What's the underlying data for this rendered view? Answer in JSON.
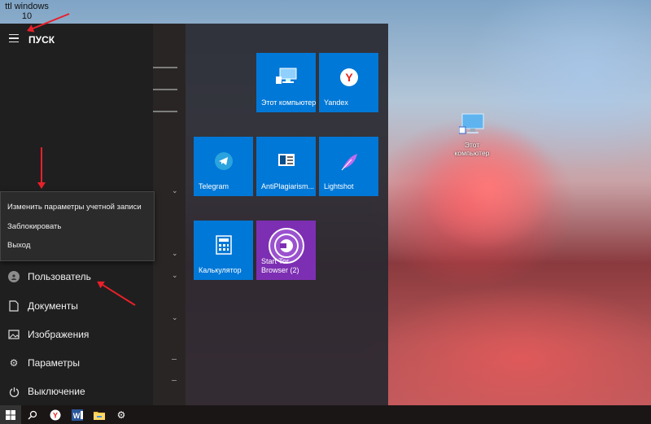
{
  "watermark": {
    "line1": "ttl windows",
    "line2": "10"
  },
  "start": {
    "title": "ПУСК",
    "account_menu": [
      "Изменить параметры учетной записи",
      "Заблокировать",
      "Выход"
    ],
    "rail_items": [
      {
        "icon": "user-avatar-icon",
        "label": "Пользователь"
      },
      {
        "icon": "document-icon",
        "label": "Документы"
      },
      {
        "icon": "image-icon",
        "label": "Изображения"
      },
      {
        "icon": "gear-icon",
        "label": "Параметры"
      },
      {
        "icon": "power-icon",
        "label": "Выключение"
      }
    ]
  },
  "tiles": [
    {
      "label": "Этот компьютер",
      "icon": "computer-icon"
    },
    {
      "label": "Yandex",
      "icon": "yandex-icon"
    },
    {
      "label": "Telegram",
      "icon": "telegram-icon"
    },
    {
      "label": "AntiPlagiarism...",
      "icon": "antiplagiarism-icon"
    },
    {
      "label": "Lightshot",
      "icon": "feather-icon"
    },
    {
      "label": "Калькулятор",
      "icon": "calculator-icon"
    },
    {
      "label": "Start Tor Browser (2)",
      "icon": "tor-icon"
    }
  ],
  "desktop": {
    "icon_label": "Этот компьютер"
  },
  "colors": {
    "tile_blue": "#0078d7",
    "tor_purple": "#7d2fb3",
    "arrow_red": "#e8202a"
  },
  "taskbar": [
    "windows-start-icon",
    "search-icon",
    "yandex-browser-icon",
    "word-icon",
    "file-explorer-icon",
    "settings-gear-icon"
  ]
}
